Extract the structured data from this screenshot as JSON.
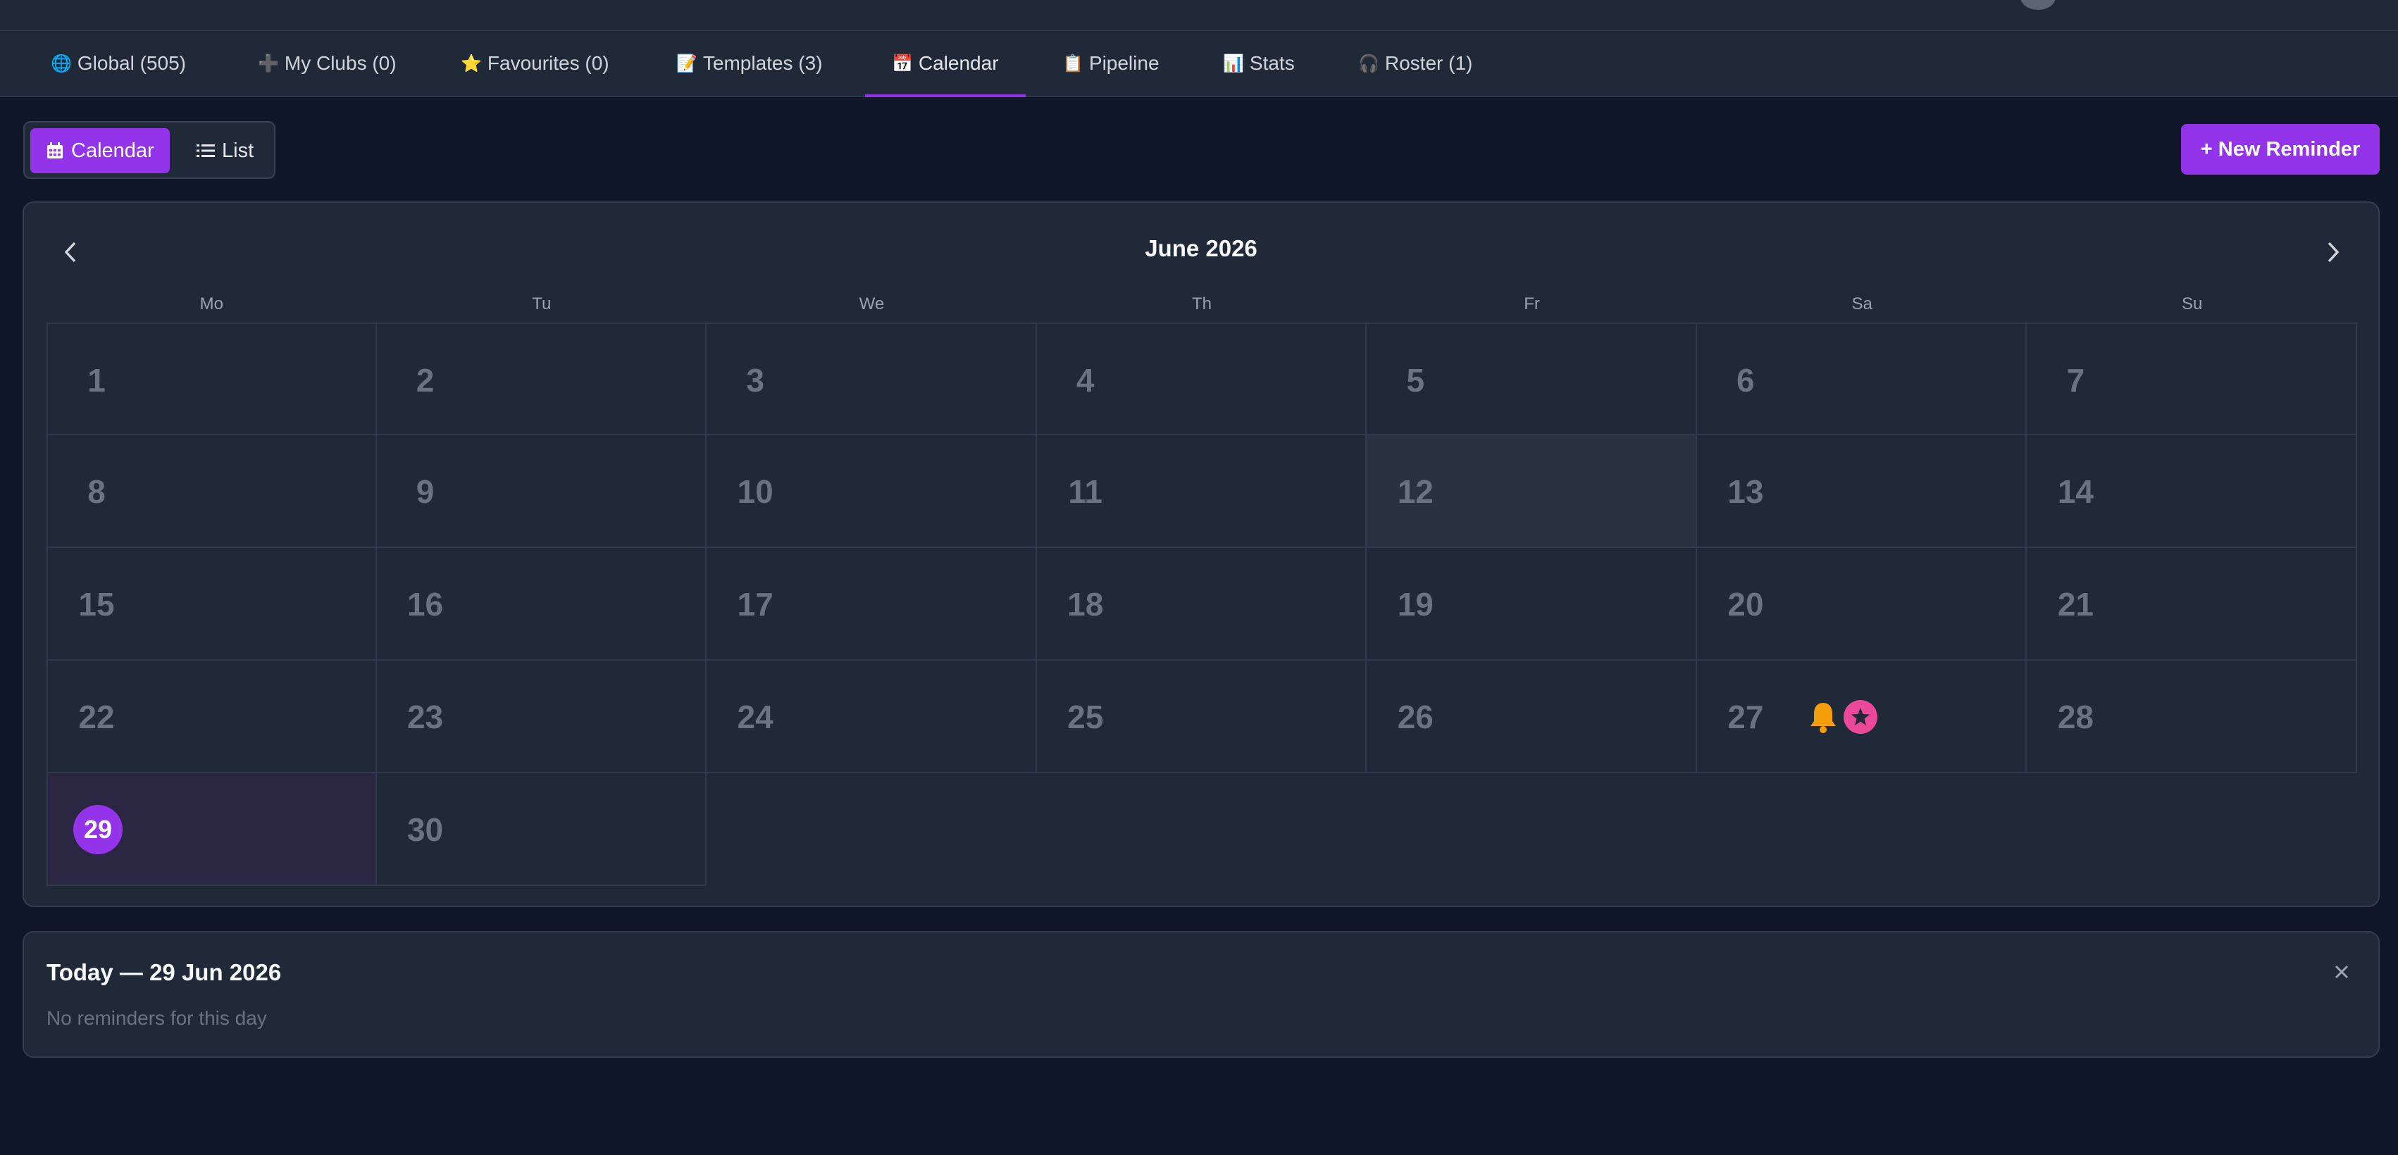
{
  "tabs": [
    {
      "icon": "🌐",
      "label": "Global (505)"
    },
    {
      "icon": "➕",
      "label": "My Clubs (0)"
    },
    {
      "icon": "⭐",
      "label": "Favourites (0)"
    },
    {
      "icon": "📝",
      "label": "Templates (3)"
    },
    {
      "icon": "📅",
      "label": "Calendar"
    },
    {
      "icon": "📋",
      "label": "Pipeline"
    },
    {
      "icon": "📊",
      "label": "Stats"
    },
    {
      "icon": "🎧",
      "label": "Roster (1)"
    }
  ],
  "active_tab": "Calendar",
  "view_toggle": {
    "calendar_label": "Calendar",
    "list_label": "List",
    "active": "Calendar"
  },
  "new_reminder_label": "+ New Reminder",
  "calendar": {
    "month_title": "June 2026",
    "weekdays": [
      "Mo",
      "Tu",
      "We",
      "Th",
      "Fr",
      "Sa",
      "Su"
    ],
    "first_weekday_index": 0,
    "days_in_month": 30,
    "today": 29,
    "hover_day": 12,
    "event_days": [
      {
        "day": 27,
        "icons": [
          "bell-icon",
          "star-badge-icon"
        ]
      }
    ]
  },
  "day_panel": {
    "title": "Today — 29 Jun 2026",
    "empty_text": "No reminders for this day"
  },
  "colors": {
    "accent": "#9333ea",
    "bell": "#f59e0b",
    "star_badge": "#ec4899"
  }
}
